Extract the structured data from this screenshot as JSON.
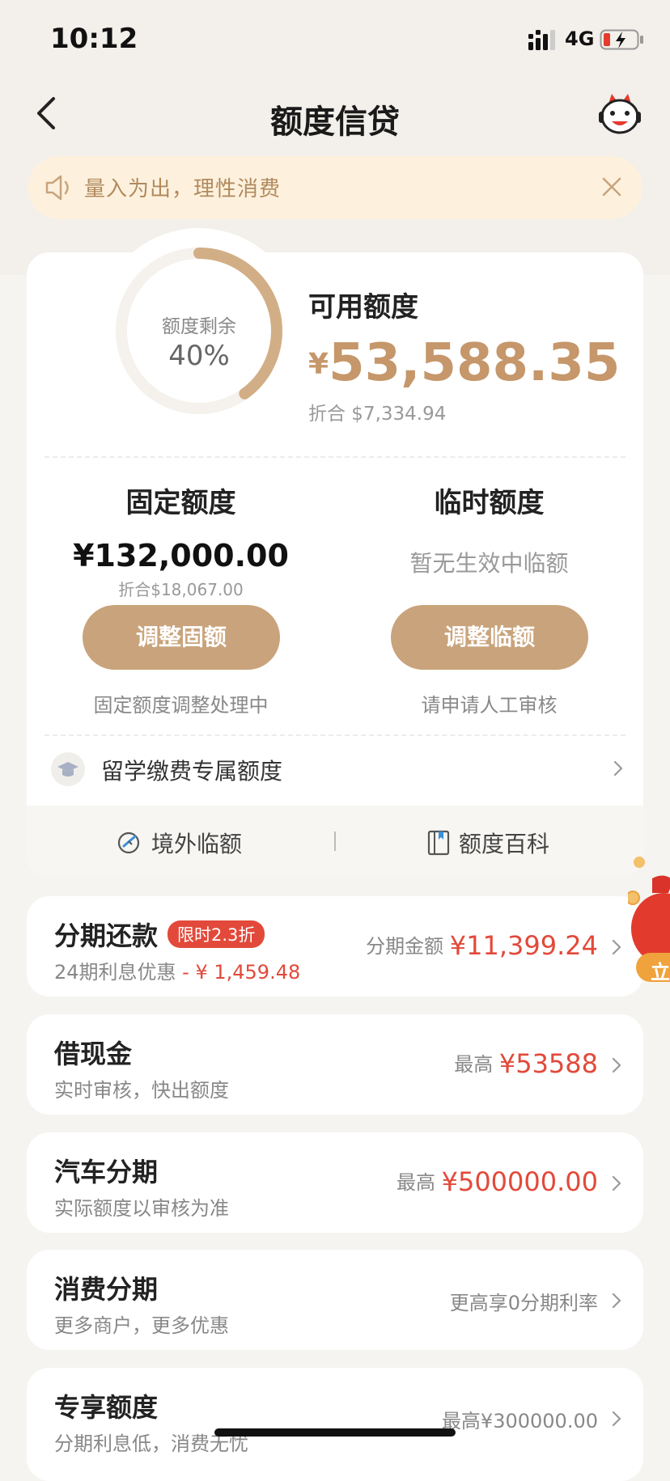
{
  "status_bar": {
    "time": "10:12",
    "network": "4G"
  },
  "header": {
    "title": "额度信贷"
  },
  "notice": {
    "text": "量入为出，理性消费"
  },
  "credit": {
    "ring_label": "额度剩余",
    "ring_value": "40%",
    "ring_fraction": 0.4,
    "available_label": "可用额度",
    "currency_symbol": "¥",
    "available_amount": "53,588.35",
    "available_converted": "折合 $7,334.94",
    "fixed": {
      "title": "固定额度",
      "amount": "¥132,000.00",
      "converted": "折合$18,067.00",
      "button": "调整固额",
      "note": "固定额度调整处理中"
    },
    "temporary": {
      "title": "临时额度",
      "status": "暂无生效中临额",
      "button": "调整临额",
      "note": "请申请人工审核"
    },
    "study_abroad": "留学缴费专属额度",
    "links": {
      "overseas": "境外临额",
      "wiki": "额度百科"
    }
  },
  "products": {
    "installment": {
      "title": "分期还款",
      "tag": "限时2.3折",
      "sub_prefix": "24期利息优惠",
      "sub_discount": " - ¥ 1,459.48",
      "right_label": "分期金额",
      "right_value": "¥11,399.24"
    },
    "cash": {
      "title": "借现金",
      "sub": "实时审核，快出额度",
      "right_label": "最高",
      "right_value": "¥53588"
    },
    "car": {
      "title": "汽车分期",
      "sub": "实际额度以审核为准",
      "right_label": "最高",
      "right_value": "¥500000.00"
    },
    "consumer": {
      "title": "消费分期",
      "sub": "更多商户，更多优惠",
      "right_text": "更高享0分期利率"
    },
    "exclusive": {
      "title": "专享额度",
      "sub": "分期利息低，消费无忧",
      "right_text": "最高¥300000.00"
    }
  },
  "float_button": {
    "label": "立"
  },
  "colors": {
    "accent_gold": "#c9a37b",
    "amount_gold": "#c5976a",
    "red": "#e2493a",
    "notice_bg": "#fdf1de"
  }
}
